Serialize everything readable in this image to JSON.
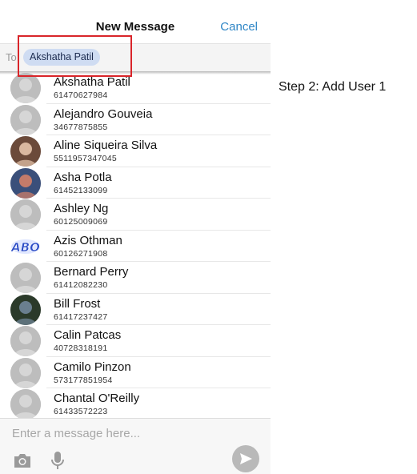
{
  "header": {
    "title": "New Message",
    "cancel_label": "Cancel"
  },
  "to_bar": {
    "label": "To:",
    "recipient": "Akshatha Patil"
  },
  "contacts": [
    {
      "name": "Akshatha Patil",
      "phone": "61470627984",
      "avatar": "default"
    },
    {
      "name": "Alejandro Gouveia",
      "phone": "34677875855",
      "avatar": "default"
    },
    {
      "name": "Aline Siqueira Silva",
      "phone": "5511957347045",
      "avatar": "photo"
    },
    {
      "name": "Asha Potla",
      "phone": "61452133099",
      "avatar": "photo"
    },
    {
      "name": "Ashley Ng",
      "phone": "60125009069",
      "avatar": "default"
    },
    {
      "name": "Azis Othman",
      "phone": "60126271908",
      "avatar": "logo"
    },
    {
      "name": "Bernard Perry",
      "phone": "61412082230",
      "avatar": "default"
    },
    {
      "name": "Bill Frost",
      "phone": "61417237427",
      "avatar": "photo"
    },
    {
      "name": "Calin Patcas",
      "phone": "40728318191",
      "avatar": "default"
    },
    {
      "name": "Camilo Pinzon",
      "phone": "573177851954",
      "avatar": "default"
    },
    {
      "name": "Chantal O'Reilly",
      "phone": "61433572223",
      "avatar": "default"
    }
  ],
  "logo_avatar_text": "ABO",
  "composer": {
    "placeholder": "Enter a message here...",
    "icons": [
      "camera-icon",
      "microphone-icon",
      "send-icon"
    ]
  },
  "caption": "Step 2: Add User 1",
  "colors": {
    "accent": "#2f86c6",
    "chip": "#cfdcf2",
    "highlight": "#d9252a"
  }
}
